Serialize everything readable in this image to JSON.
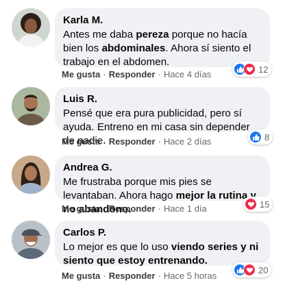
{
  "actions": {
    "like": "Me gusta",
    "reply": "Responder",
    "separator": "·"
  },
  "colors": {
    "like": "#1877f2",
    "love": "#f0284a",
    "bubble": "#eff1f4"
  },
  "comments": [
    {
      "name": "Karla M.",
      "text_parts": [
        "Antes me daba ",
        "pereza",
        " porque no hacía bien los ",
        "abdominales",
        ". Ahora sí siento el trabajo en el abdomen."
      ],
      "time": "Hace 4 días",
      "reactions": [
        "like-icon",
        "love-icon"
      ],
      "count": "12"
    },
    {
      "name": "Luis R.",
      "text_parts": [
        "Pensé que era pura publicidad, pero sí ayuda. Entreno en mi casa sin depender de nadie."
      ],
      "time": "Hace 2 días",
      "reactions": [
        "like-icon"
      ],
      "count": "8"
    },
    {
      "name": "Andrea G.",
      "text_parts": [
        "Me frustraba porque mis pies se levantaban. Ahora hago ",
        "mejor la rutina y no abandono."
      ],
      "time": "Hace 1 día",
      "reactions": [
        "love-icon"
      ],
      "count": "15"
    },
    {
      "name": "Carlos P.",
      "text_parts": [
        "Lo mejor es que lo uso ",
        "viendo series y ni siento que estoy entrenando."
      ],
      "time": "Hace 5 horas",
      "reactions": [
        "like-icon",
        "love-icon"
      ],
      "count": "20"
    }
  ]
}
